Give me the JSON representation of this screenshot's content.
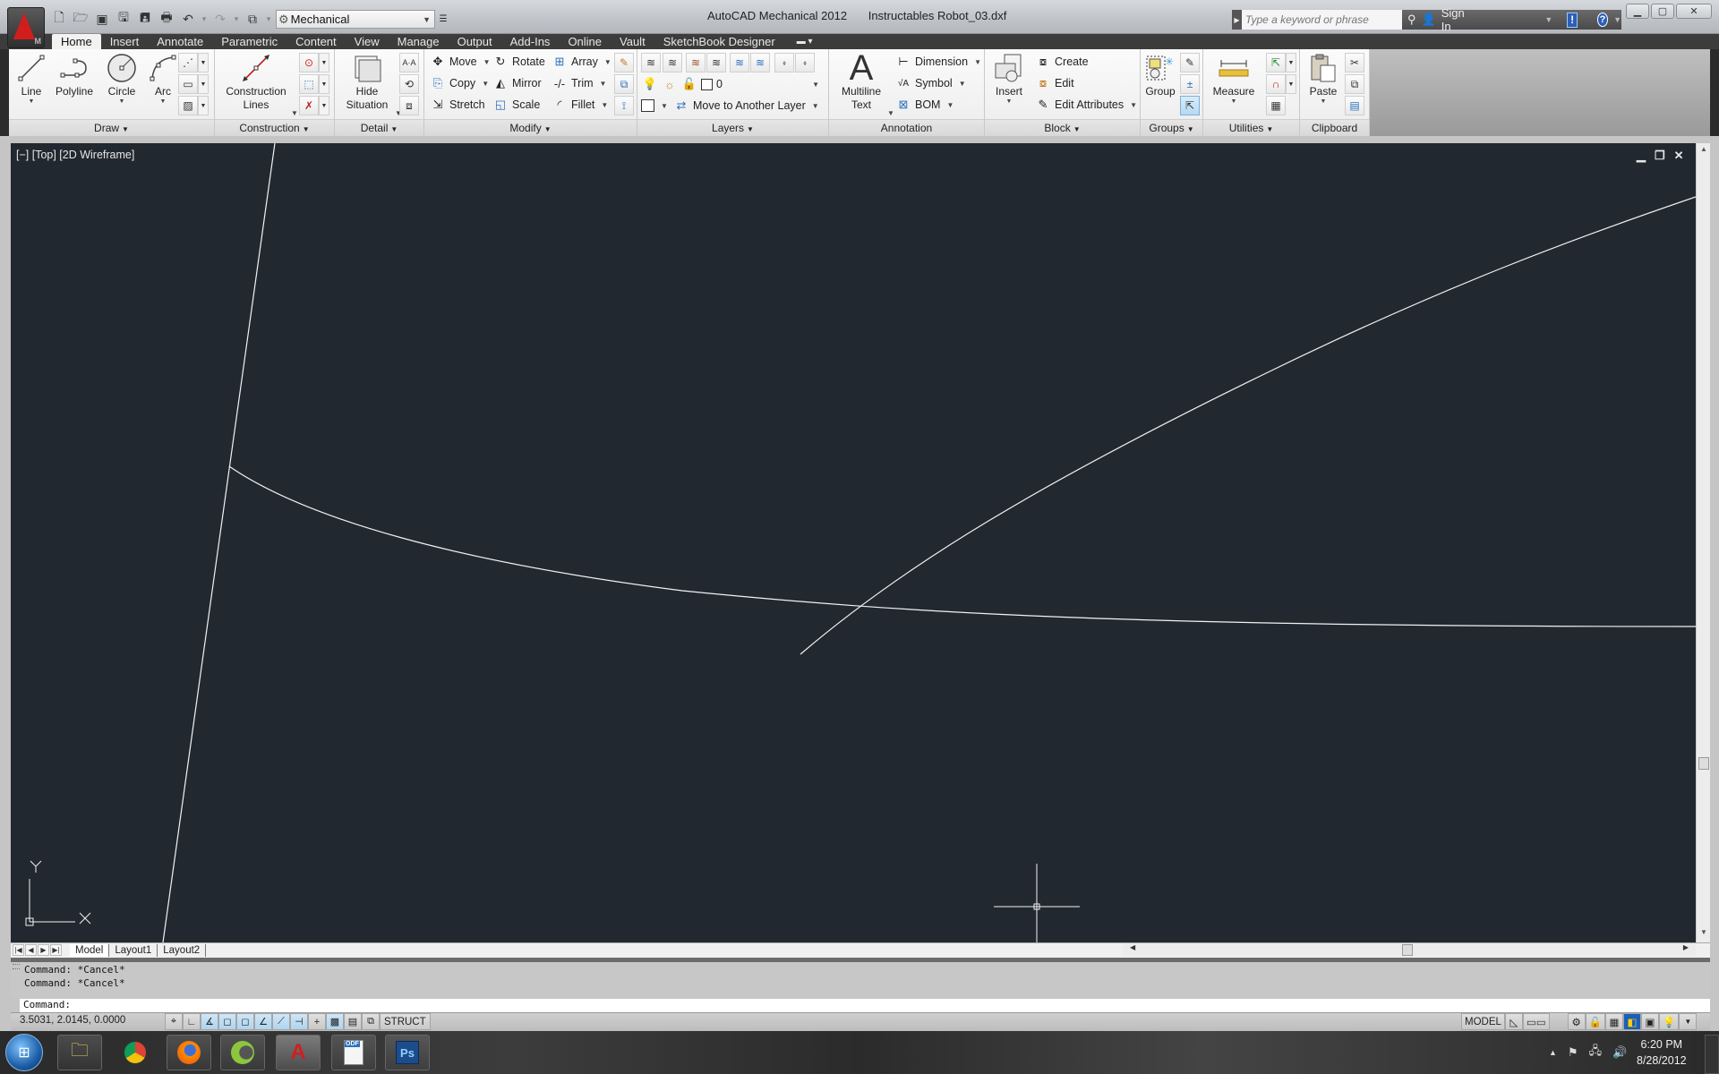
{
  "titlebar": {
    "app_name": "AutoCAD Mechanical 2012",
    "file_name": "Instructables Robot_03.dxf",
    "workspace": "Mechanical",
    "search_placeholder": "Type a keyword or phrase",
    "sign_in": "Sign In",
    "app_badge": "M"
  },
  "quick_access": [
    {
      "icon": "new-icon",
      "glyph": "🗋"
    },
    {
      "icon": "open-icon",
      "glyph": "📂"
    },
    {
      "icon": "save-to-vault-icon",
      "glyph": "▣"
    },
    {
      "icon": "save-icon",
      "glyph": "💾"
    },
    {
      "icon": "save-as-icon",
      "glyph": "🖫"
    },
    {
      "icon": "plot-icon",
      "glyph": "🖶"
    },
    {
      "icon": "undo-icon",
      "glyph": "↶"
    },
    {
      "icon": "redo-icon",
      "glyph": "↷"
    },
    {
      "icon": "workspace-switch-icon",
      "glyph": "⧉"
    }
  ],
  "tabs": [
    "Home",
    "Insert",
    "Annotate",
    "Parametric",
    "Content",
    "View",
    "Manage",
    "Output",
    "Add-Ins",
    "Online",
    "Vault",
    "SketchBook Designer"
  ],
  "active_tab": "Home",
  "panels": {
    "draw": {
      "title": "Draw",
      "line": "Line",
      "polyline": "Polyline",
      "circle": "Circle",
      "arc": "Arc"
    },
    "construction": {
      "title": "Construction",
      "lines_1": "Construction",
      "lines_2": "Lines"
    },
    "detail": {
      "title": "Detail",
      "hide_1": "Hide",
      "hide_2": "Situation"
    },
    "modify": {
      "title": "Modify",
      "move": "Move",
      "rotate": "Rotate",
      "array": "Array",
      "copy": "Copy",
      "mirror": "Mirror",
      "trim": "Trim",
      "stretch": "Stretch",
      "scale": "Scale",
      "fillet": "Fillet"
    },
    "layers": {
      "title": "Layers",
      "current_layer": "0",
      "move_layer": "Move to Another Layer"
    },
    "annotation": {
      "title": "Annotation",
      "mtext_1": "Multiline",
      "mtext_2": "Text",
      "dimension": "Dimension",
      "symbol": "Symbol",
      "bom": "BOM"
    },
    "block": {
      "title": "Block",
      "insert": "Insert",
      "create": "Create",
      "edit": "Edit",
      "edit_attributes": "Edit Attributes"
    },
    "groups": {
      "title": "Groups",
      "group": "Group"
    },
    "utilities": {
      "title": "Utilities",
      "measure": "Measure"
    },
    "clipboard": {
      "title": "Clipboard",
      "paste": "Paste"
    }
  },
  "viewport": {
    "label": "[−] [Top] [2D Wireframe]",
    "background": "#212830",
    "ucs_x": "X",
    "ucs_y": "Y"
  },
  "layout_tabs": [
    "Model",
    "Layout1",
    "Layout2"
  ],
  "active_layout": "Model",
  "command": {
    "history": [
      "Command: *Cancel*",
      "Command: *Cancel*"
    ],
    "prompt": "Command:"
  },
  "status": {
    "coordinates": "3.5031, 2.0145, 0.0000",
    "struct": "STRUCT",
    "model": "MODEL"
  },
  "taskbar": {
    "apps": [
      "Windows Explorer",
      "Google Chrome",
      "Firefox",
      "Camtasia",
      "AutoCAD Mechanical",
      "PDF",
      "Photoshop"
    ],
    "time": "6:20 PM",
    "date": "8/28/2012"
  }
}
